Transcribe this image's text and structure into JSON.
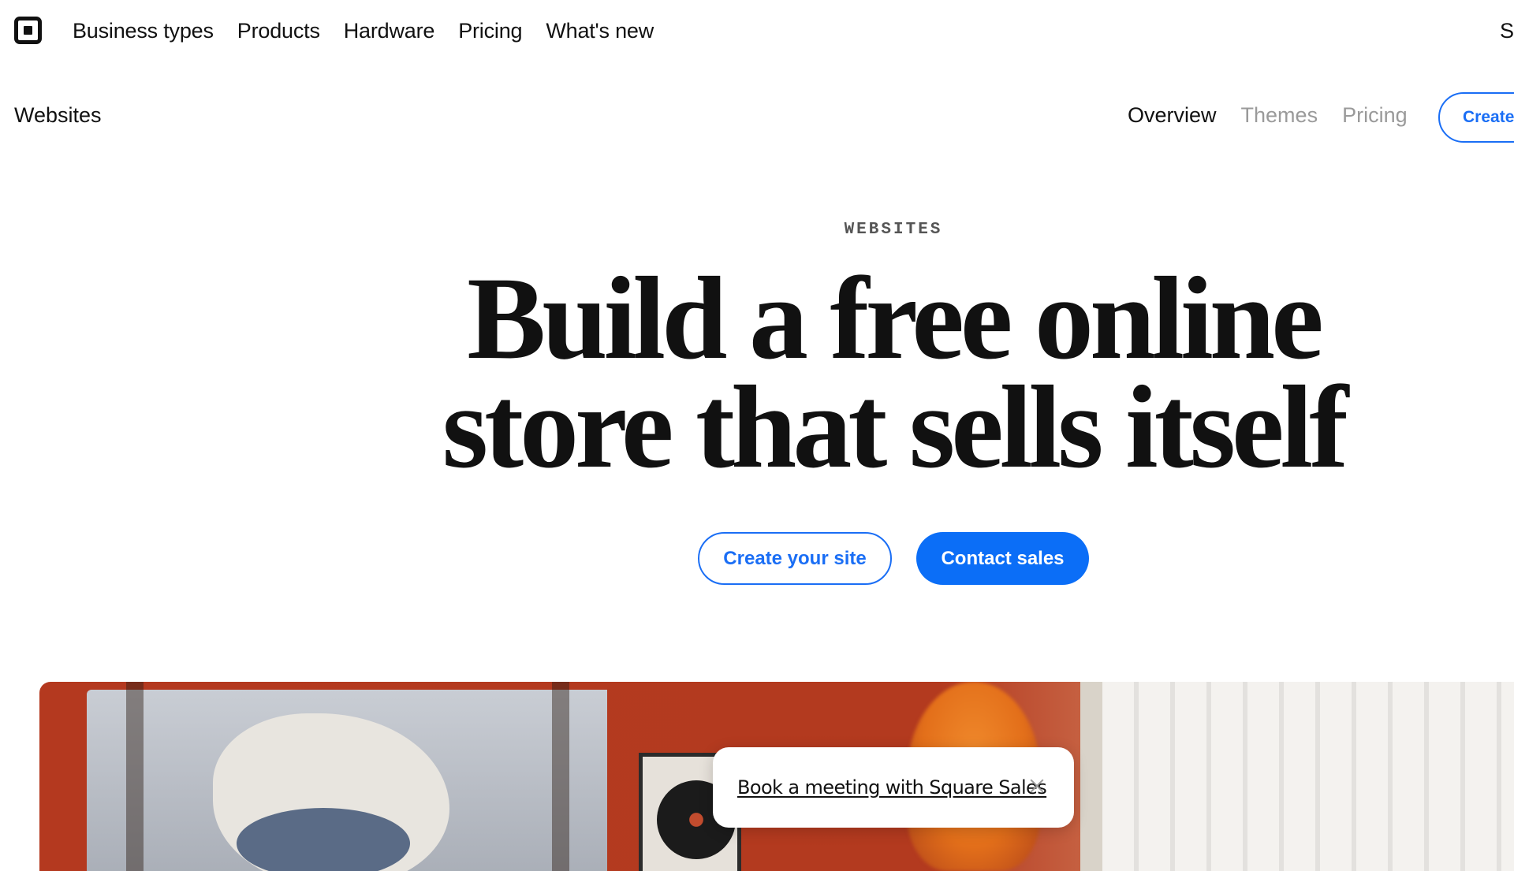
{
  "topnav": {
    "logo_name": "square-logo",
    "links": [
      "Business types",
      "Products",
      "Hardware",
      "Pricing",
      "What's new"
    ],
    "cut_link": "S"
  },
  "subnav": {
    "title": "Websites",
    "tabs": [
      "Overview",
      "Themes",
      "Pricing"
    ],
    "active_tab": "Overview",
    "create_button": "Create"
  },
  "hero": {
    "eyebrow": "WEBSITES",
    "headline_line1": "Build a free online",
    "headline_line2": "store that sells itself",
    "primary_cta": "Create your site",
    "secondary_cta": "Contact sales"
  },
  "toast": {
    "link": "Book a meeting with Square Sales",
    "close_icon": "close-icon"
  },
  "colors": {
    "accent": "#1a6ef5",
    "accent_solid": "#0b6ef7",
    "text": "#111111",
    "muted": "#9a9a9a"
  }
}
